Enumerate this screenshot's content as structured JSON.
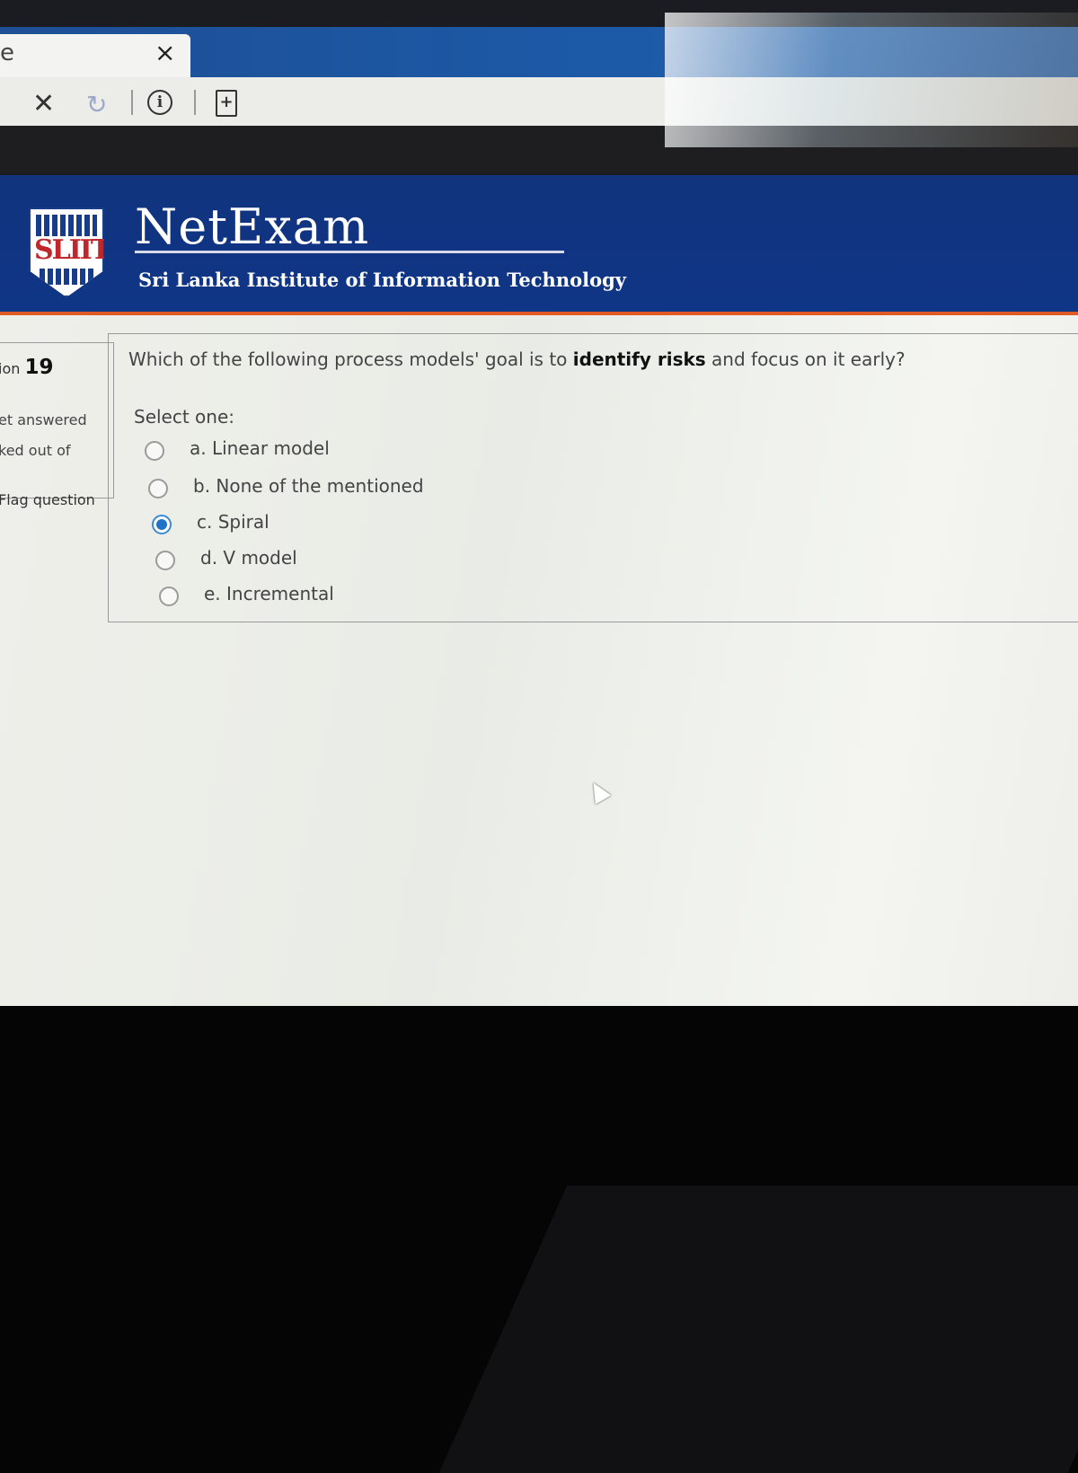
{
  "browser": {
    "tab_title": "e",
    "tab_close_glyph": "×",
    "stop_glyph": "✕",
    "reload_glyph": "↻",
    "info_glyph": "i",
    "page_glyph": "+"
  },
  "header": {
    "brand": "NetExam",
    "institute": "Sri Lanka Institute of Information Technology",
    "logo_text": "SLIIT"
  },
  "question_info": {
    "label": "ion",
    "number": "19",
    "status": "et answered",
    "marked": "ked out of",
    "flag": "Flag question"
  },
  "question": {
    "text_before": "Which of the following process models' goal is to ",
    "highlight": "identify risks",
    "text_after": " and focus on it early?",
    "select_prompt": "Select one:",
    "options": [
      {
        "label": "a. Linear model",
        "selected": false
      },
      {
        "label": "b. None of the mentioned",
        "selected": false
      },
      {
        "label": "c. Spiral",
        "selected": true
      },
      {
        "label": "d. V model",
        "selected": false
      },
      {
        "label": "e. Incremental",
        "selected": false
      }
    ]
  },
  "colors": {
    "header_blue": "#11347d",
    "accent_orange": "#e05a24",
    "radio_selected": "#1f73c8"
  }
}
